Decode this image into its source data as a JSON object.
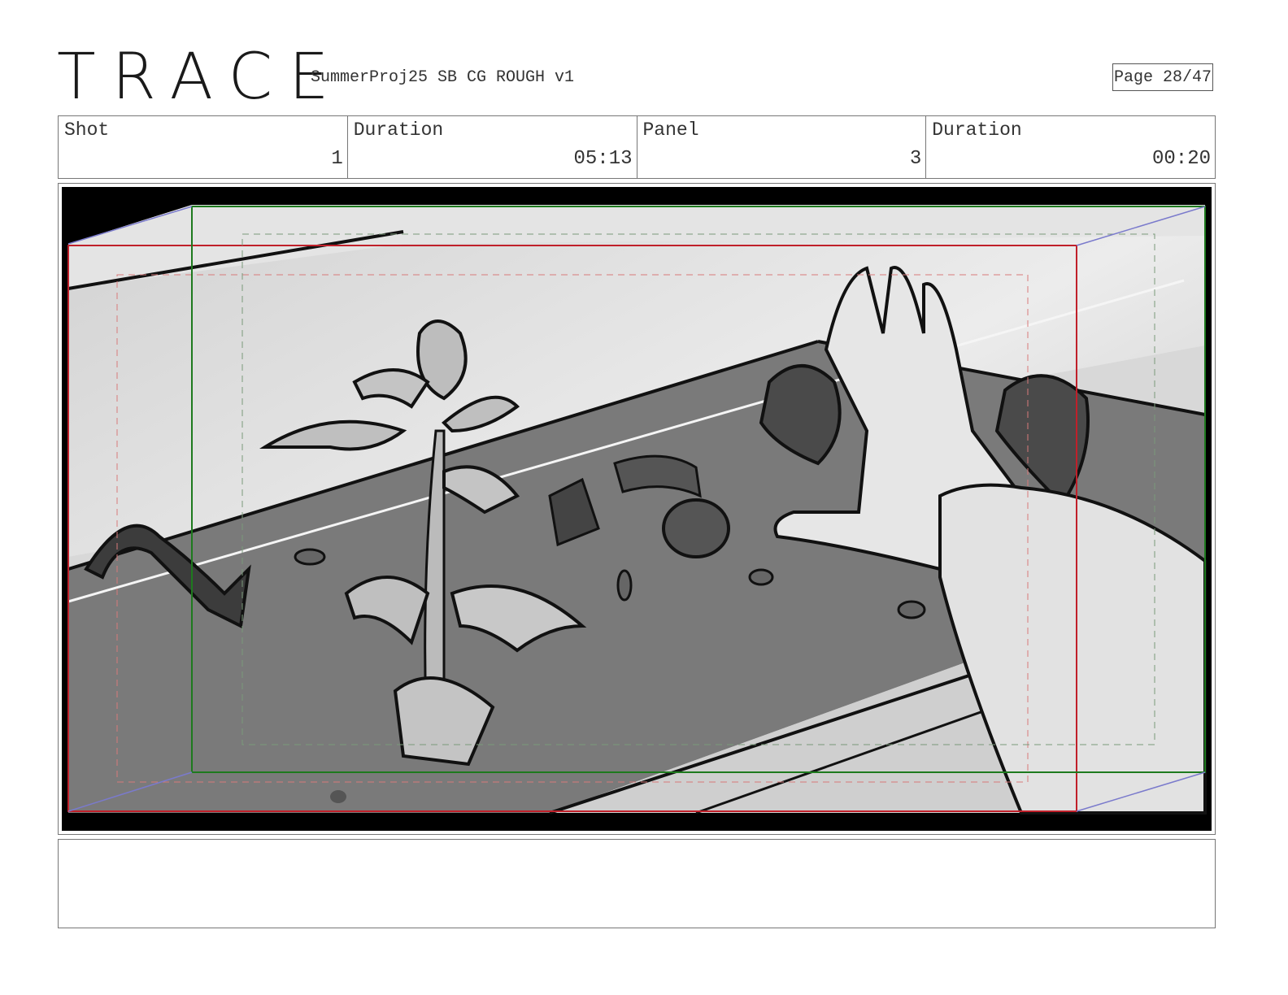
{
  "header": {
    "logo": "TRACE",
    "project_title": "SummerProj25 SB CG ROUGH v1",
    "page_indicator": "Page 28/47"
  },
  "info": {
    "shot_label": "Shot",
    "shot_value": "1",
    "shot_duration_label": "Duration",
    "shot_duration_value": "05:13",
    "panel_label": "Panel",
    "panel_value": "3",
    "panel_duration_label": "Duration",
    "panel_duration_value": "00:20"
  },
  "colors": {
    "frame_red": "#c0202a",
    "frame_green": "#1e7a1e",
    "guide_blue": "#7a7acc"
  }
}
